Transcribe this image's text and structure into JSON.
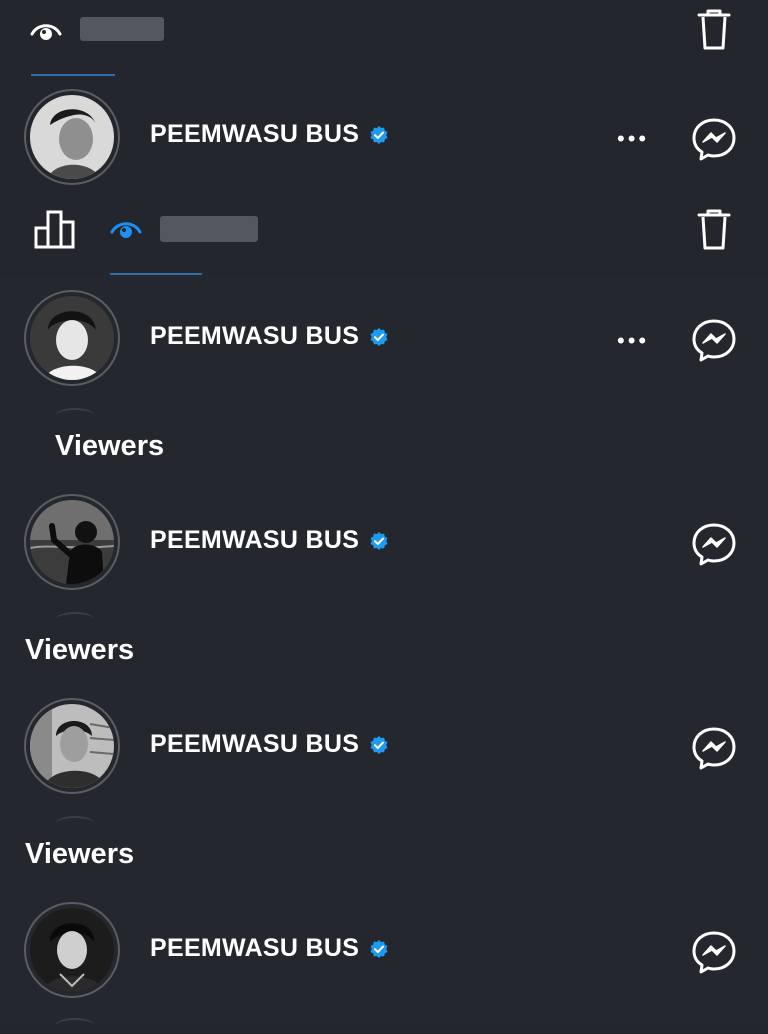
{
  "story_rows": [
    {
      "name": "PEEMWASU BUS",
      "verified": true,
      "has_more_menu": true
    },
    {
      "name": "PEEMWASU BUS",
      "verified": true,
      "has_more_menu": true
    }
  ],
  "viewer_sections": [
    {
      "label": "Viewers",
      "name": "PEEMWASU BUS",
      "verified": true
    },
    {
      "label": "Viewers",
      "name": "PEEMWASU BUS",
      "verified": true
    },
    {
      "label": "Viewers",
      "name": "PEEMWASU BUS",
      "verified": true
    }
  ],
  "icons": {
    "eye": "eye-icon",
    "eye_active": "eye-icon-blue",
    "trash": "trash-icon",
    "insights": "bar-chart-icon",
    "message": "messenger-icon",
    "more": "more-dots-icon",
    "verified": "verified-badge-icon"
  },
  "more_glyph": "•••",
  "colors": {
    "background": "#23262c",
    "accent": "#1d8ff2",
    "verified": "#1d9bf0",
    "redaction": "#54575d"
  }
}
